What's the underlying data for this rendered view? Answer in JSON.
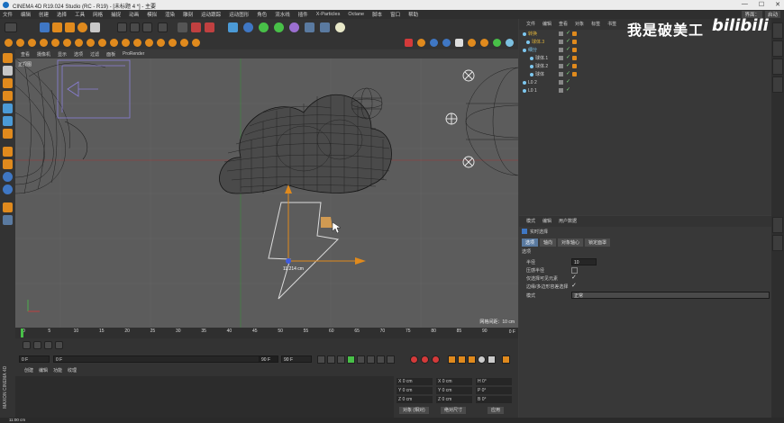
{
  "window": {
    "title": "CINEMA 4D R19.024 Studio (RC - R19) - [未标题 4 *] - 主要",
    "min": "—",
    "max": "☐",
    "close": "✕"
  },
  "menubar": {
    "items": [
      "文件",
      "编辑",
      "创建",
      "选择",
      "工具",
      "网格",
      "捕捉",
      "动画",
      "模拟",
      "渲染",
      "雕刻",
      "运动跟踪",
      "运动图形",
      "角色",
      "流水线",
      "插件",
      "X-Particles",
      "Octane",
      "脚本",
      "窗口",
      "帮助"
    ],
    "layout_label": "界面：",
    "layout_value": "启动"
  },
  "viewport": {
    "menu": [
      "查看",
      "摄像机",
      "显示",
      "选项",
      "过滤",
      "面板",
      "ProRender"
    ],
    "label": "正视图",
    "grid_info": "网格间距：10 cm",
    "measure": "11.214 cm"
  },
  "timeline": {
    "ticks": [
      "0",
      "5",
      "10",
      "15",
      "20",
      "25",
      "30",
      "35",
      "40",
      "45",
      "50",
      "55",
      "60",
      "65",
      "70",
      "75",
      "80",
      "85",
      "90"
    ],
    "end_label": "0 F"
  },
  "playback": {
    "start": "0 F",
    "current": "0 F",
    "end": "90 F",
    "end2": "90 F"
  },
  "material_manager": {
    "tabs": [
      "创建",
      "编辑",
      "功能",
      "纹理"
    ]
  },
  "coordinates": {
    "x_pos": "0 cm",
    "y_pos": "0 cm",
    "z_pos": "0 cm",
    "x_size": "0 cm",
    "y_size": "0 cm",
    "z_size": "0 cm",
    "h": "0°",
    "p": "0°",
    "b": "0°",
    "x_label": "X",
    "y_label": "Y",
    "z_label": "Z",
    "xs_label": "X",
    "ys_label": "Y",
    "zs_label": "Z",
    "h_label": "H",
    "p_label": "P",
    "b_label": "B",
    "mode_btn": "对象 (相对)",
    "size_btn": "绝对尺寸",
    "apply_btn": "应用"
  },
  "object_manager": {
    "menu": [
      "文件",
      "编辑",
      "查看",
      "对象",
      "标签",
      "书签"
    ],
    "objects": [
      {
        "name": "转换",
        "color": "#e0b43a",
        "indent": 0
      },
      {
        "name": "球体.3",
        "color": "#e0b43a",
        "indent": 4
      },
      {
        "name": "细分",
        "color": "#7ec8f0",
        "indent": 0
      },
      {
        "name": "球体.1",
        "color": "#cfcfcf",
        "indent": 8
      },
      {
        "name": "球体.2",
        "color": "#cfcfcf",
        "indent": 8
      },
      {
        "name": "球体",
        "color": "#cfcfcf",
        "indent": 8
      },
      {
        "name": "L0 2",
        "color": "#cfcfcf",
        "indent": 0
      },
      {
        "name": "L0 1",
        "color": "#cfcfcf",
        "indent": 0
      }
    ]
  },
  "attributes": {
    "menu": [
      "模式",
      "编辑",
      "用户数据"
    ],
    "object_name": "实时选择",
    "tabs": [
      "选项",
      "轴向",
      "对象轴心",
      "锁定面罩"
    ],
    "section": "选项",
    "radius_label": "半径",
    "radius_value": "10",
    "pressure_label": "压感半径",
    "only_visible_label": "仅选择可见元素",
    "edge_label": "边缘/多边形容差选择",
    "mode_label": "模式",
    "mode_value": "正常"
  },
  "status": {
    "text": "11:00 cm"
  },
  "watermark": {
    "text": "我是破美工",
    "logo": "bilibili"
  },
  "maxon_label": "MAXON CINEMA 4D",
  "colors": {
    "accent_orange": "#e08a1d",
    "selection_blue": "#3f77c4",
    "axis_red": "#d43a3a",
    "axis_green": "#48c048"
  }
}
